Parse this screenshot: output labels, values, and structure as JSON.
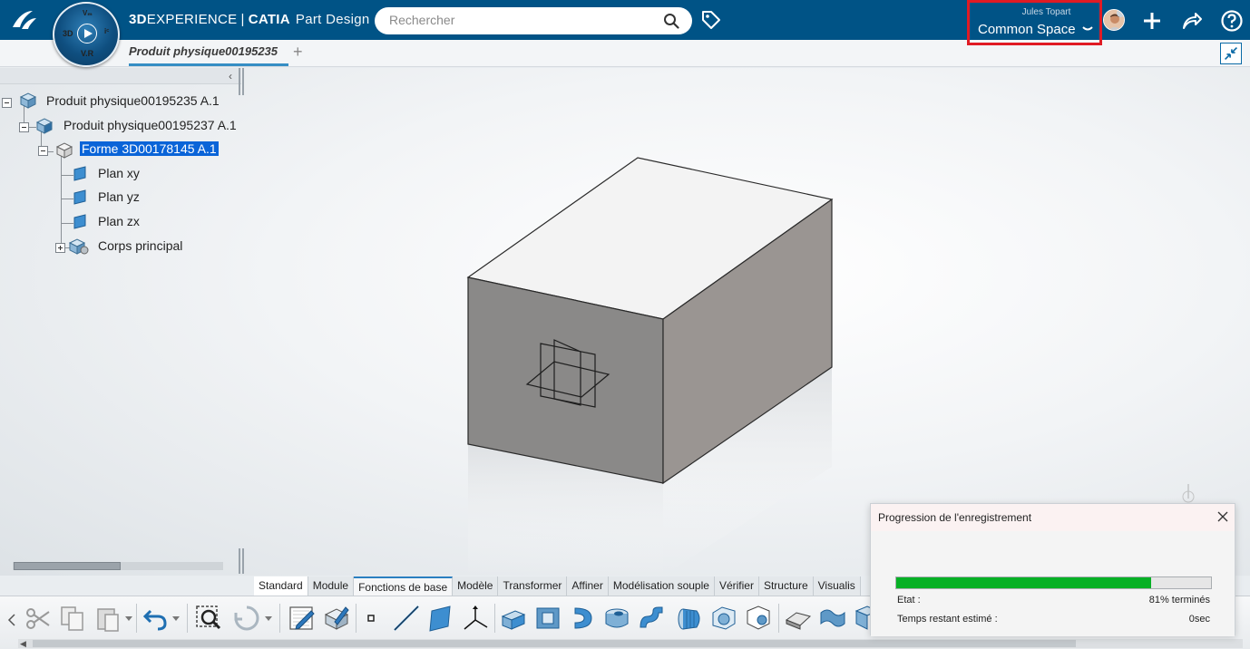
{
  "header": {
    "brand": "3D",
    "brand_rest": "EXPERIENCE",
    "app": "CATIA",
    "role": "Part Design",
    "compass": {
      "top": "Vₘ",
      "left": "3D",
      "right": "iᶜ",
      "bottom": "V.R"
    },
    "search_placeholder": "Rechercher",
    "user_name": "Jules Topart",
    "space": "Common Space"
  },
  "tabs": {
    "document": "Produit physique00195235",
    "add": "+"
  },
  "tree": {
    "root": "Produit physique00195235 A.1",
    "child": "Produit physique00195237 A.1",
    "shape": "Forme 3D00178145 A.1",
    "plan_xy": "Plan xy",
    "plan_yz": "Plan yz",
    "plan_zx": "Plan zx",
    "body": "Corps principal",
    "collapse_arrow": "‹"
  },
  "toolbar_tabs": [
    "Standard",
    "Module",
    "Fonctions de base",
    "Modèle",
    "Transformer",
    "Affiner",
    "Modélisation souple",
    "Vérifier",
    "Structure",
    "Visualis"
  ],
  "toolbar_active": "Fonctions de base",
  "dialog": {
    "title": "Progression de l'enregistrement",
    "progress": 0.81,
    "state_label": "Etat :",
    "state_value": "81% terminés",
    "remaining_label": "Temps restant estimé :",
    "remaining_value": "0sec"
  },
  "colors": {
    "topbar": "#005386",
    "highlight_box": "#e01b24",
    "progress_fill": "#06b025",
    "selection": "#0a64d8"
  }
}
